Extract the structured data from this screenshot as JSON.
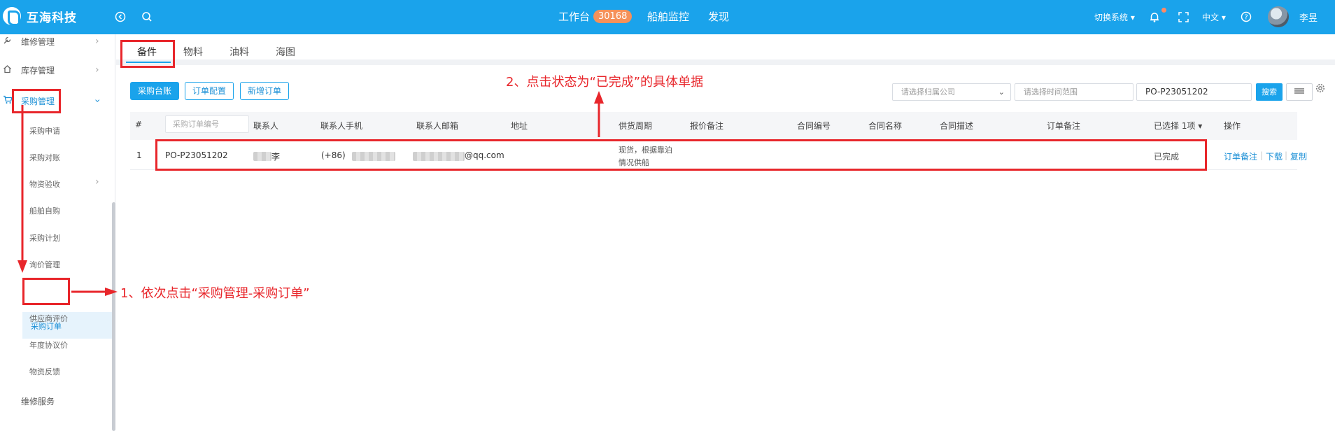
{
  "header": {
    "brand": "互海科技",
    "nav": [
      "工作台",
      "船舶监控",
      "发现"
    ],
    "badge_count": "30168",
    "switch_system": "切换系统",
    "language": "中文",
    "user_name": "李昱"
  },
  "sidebar": {
    "items": [
      {
        "label": "维修管理"
      },
      {
        "label": "库存管理"
      },
      {
        "label": "采购管理"
      }
    ],
    "sub_items": [
      "采购申请",
      "采购对账",
      "物资验收",
      "船舶自购",
      "采购计划",
      "询价管理",
      "采购订单",
      "供应商评价",
      "年度协议价",
      "物资反馈"
    ],
    "last_item": "维修服务"
  },
  "tabs": [
    "备件",
    "物料",
    "油料",
    "海图"
  ],
  "toolbar": {
    "buttons": [
      "采购台账",
      "订单配置",
      "新增订单"
    ],
    "company_placeholder": "请选择归属公司",
    "date_placeholder": "请选择时间范围",
    "search_value": "PO-P23051202",
    "search_label": "搜索"
  },
  "table": {
    "columns": [
      "#",
      "采购订单编号",
      "联系人",
      "联系人手机",
      "联系人邮箱",
      "地址",
      "供货周期",
      "报价备注",
      "合同编号",
      "合同名称",
      "合同描述",
      "订单备注",
      "已选择 1项",
      "操作"
    ],
    "row": {
      "index": "1",
      "order_no": "PO-P23051202",
      "contact_suffix": "李",
      "phone_prefix": "(+86)",
      "email_suffix": "@qq.com",
      "supply_line1": "现货，根据靠泊",
      "supply_line2": "情况供船",
      "status": "已完成",
      "actions": [
        "订单备注",
        "下载",
        "复制"
      ]
    }
  },
  "annotations": {
    "step1": "1、依次点击“采购管理-采购订单”",
    "step2": "2、点击状态为“已完成”的具体单据"
  },
  "colors": {
    "primary": "#1aa3eb",
    "annotation": "#e8262b"
  }
}
